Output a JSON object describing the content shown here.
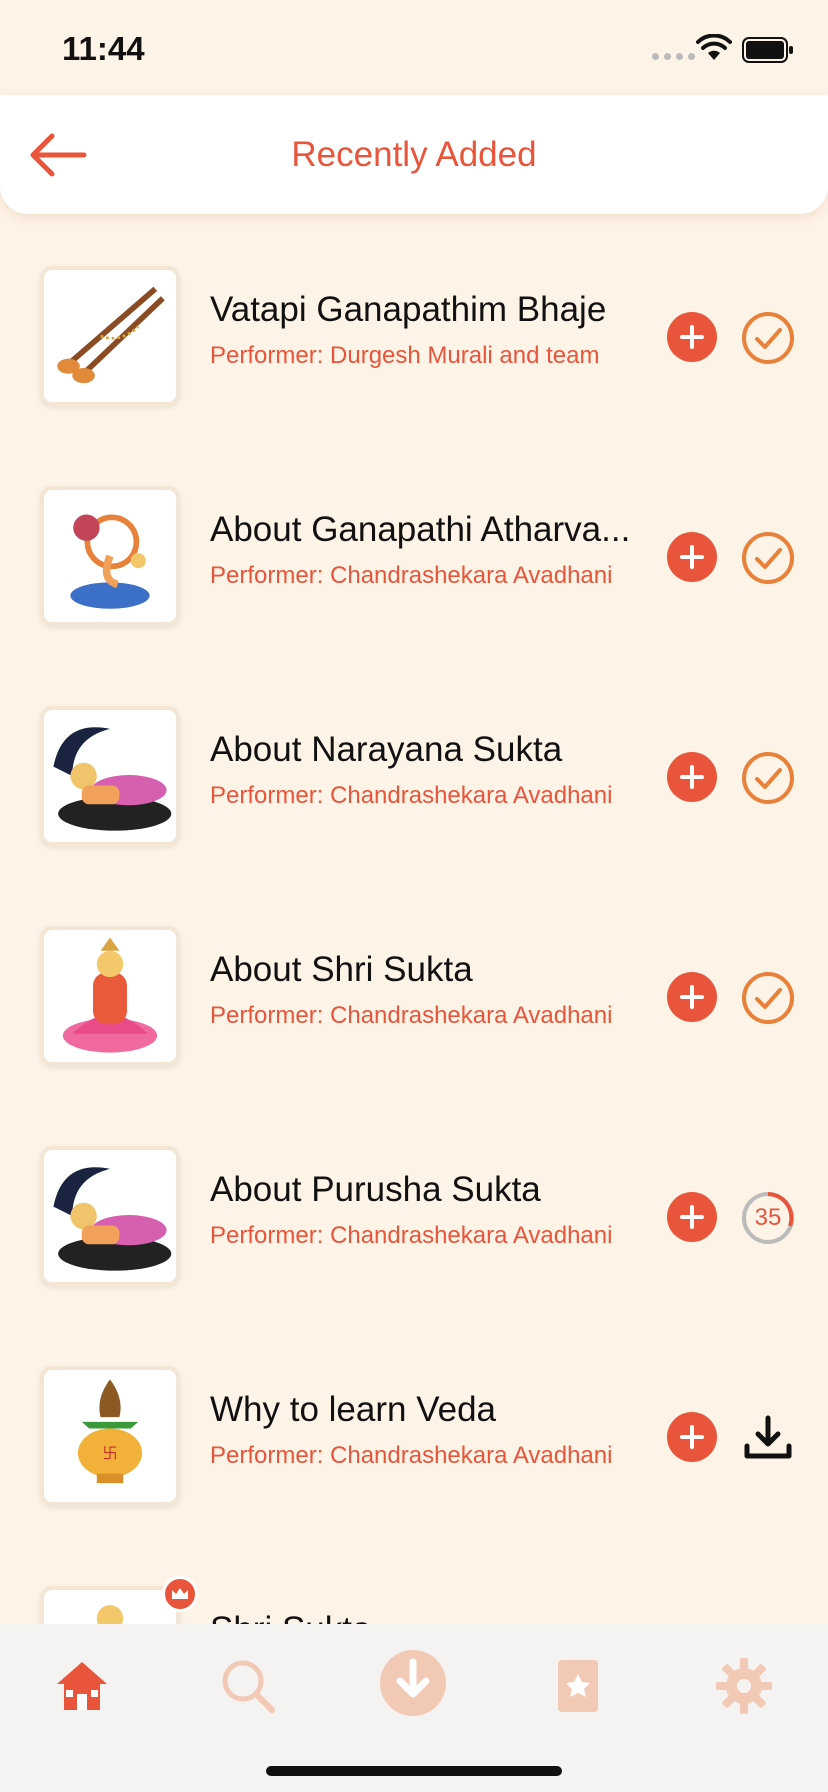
{
  "status_bar": {
    "time": "11:44"
  },
  "header": {
    "title": "Recently Added",
    "back_icon": "back-arrow-icon"
  },
  "colors": {
    "accent": "#e8553a",
    "background": "#fdf3e7",
    "text": "#111111"
  },
  "items": [
    {
      "title": "Vatapi Ganapathim Bhaje",
      "performer": "Performer: Durgesh Murali and team",
      "status": "downloaded"
    },
    {
      "title": "About Ganapathi Atharva...",
      "performer": "Performer: Chandrashekara Avadhani",
      "status": "downloaded"
    },
    {
      "title": "About Narayana Sukta",
      "performer": "Performer: Chandrashekara Avadhani",
      "status": "downloaded"
    },
    {
      "title": "About Shri Sukta",
      "performer": "Performer: Chandrashekara Avadhani",
      "status": "downloaded"
    },
    {
      "title": "About Purusha Sukta",
      "performer": "Performer: Chandrashekara Avadhani",
      "status": "downloading",
      "progress": "35"
    },
    {
      "title": "Why to learn Veda",
      "performer": "Performer: Chandrashekara Avadhani",
      "status": "download"
    },
    {
      "title": "Shri Sukta",
      "performer": "",
      "status": "premium"
    }
  ],
  "tabs": [
    {
      "name": "home",
      "icon": "home-icon",
      "active": true
    },
    {
      "name": "search",
      "icon": "search-icon",
      "active": false
    },
    {
      "name": "downloads",
      "icon": "download-icon",
      "active": false
    },
    {
      "name": "library",
      "icon": "library-icon",
      "active": false
    },
    {
      "name": "settings",
      "icon": "gear-icon",
      "active": false
    }
  ]
}
